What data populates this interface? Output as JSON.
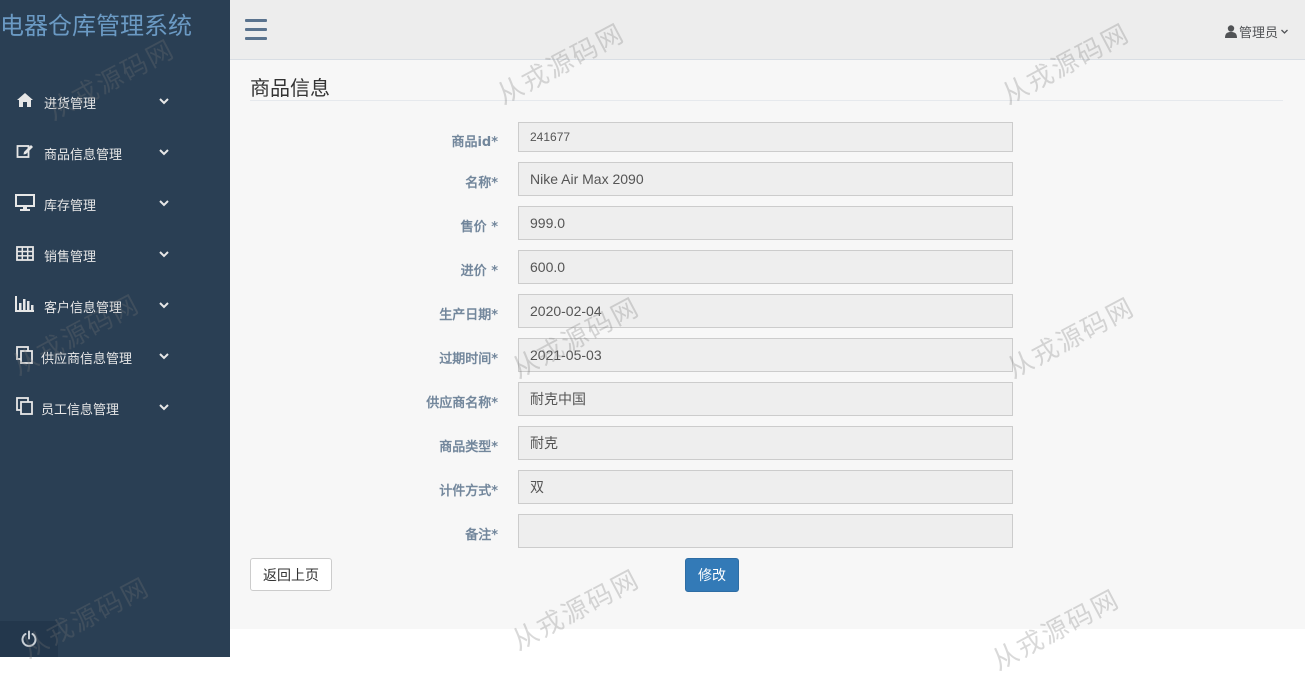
{
  "app": {
    "title": "电器仓库管理系统"
  },
  "sidebar": {
    "items": [
      {
        "label": "进货管理",
        "icon": "home-icon"
      },
      {
        "label": "商品信息管理",
        "icon": "edit-icon"
      },
      {
        "label": "库存管理",
        "icon": "monitor-icon"
      },
      {
        "label": "销售管理",
        "icon": "table-icon"
      },
      {
        "label": "客户信息管理",
        "icon": "bar-chart-icon"
      },
      {
        "label": "供应商信息管理",
        "icon": "copy-icon"
      },
      {
        "label": "员工信息管理",
        "icon": "copy-icon"
      }
    ],
    "footer_icon": "power-icon"
  },
  "header": {
    "user_label": "管理员"
  },
  "main": {
    "title": "商品信息",
    "fields": [
      {
        "label": "商品id*",
        "value": "241677"
      },
      {
        "label": "名称*",
        "value": "Nike Air Max 2090"
      },
      {
        "label": "售价 *",
        "value": "999.0"
      },
      {
        "label": "进价 *",
        "value": "600.0"
      },
      {
        "label": "生产日期*",
        "value": "2020-02-04"
      },
      {
        "label": "过期时间*",
        "value": "2021-05-03"
      },
      {
        "label": "供应商名称*",
        "value": "耐克中国"
      },
      {
        "label": "商品类型*",
        "value": "耐克"
      },
      {
        "label": "计件方式*",
        "value": "双"
      },
      {
        "label": "备注*",
        "value": ""
      }
    ],
    "back_button": "返回上页",
    "edit_button": "修改"
  },
  "watermark_text": "从戎源码网",
  "colors": {
    "sidebar": "#2a3f54",
    "brand": "#6b9ac4",
    "primary": "#337ab7",
    "label": "#73879c"
  }
}
